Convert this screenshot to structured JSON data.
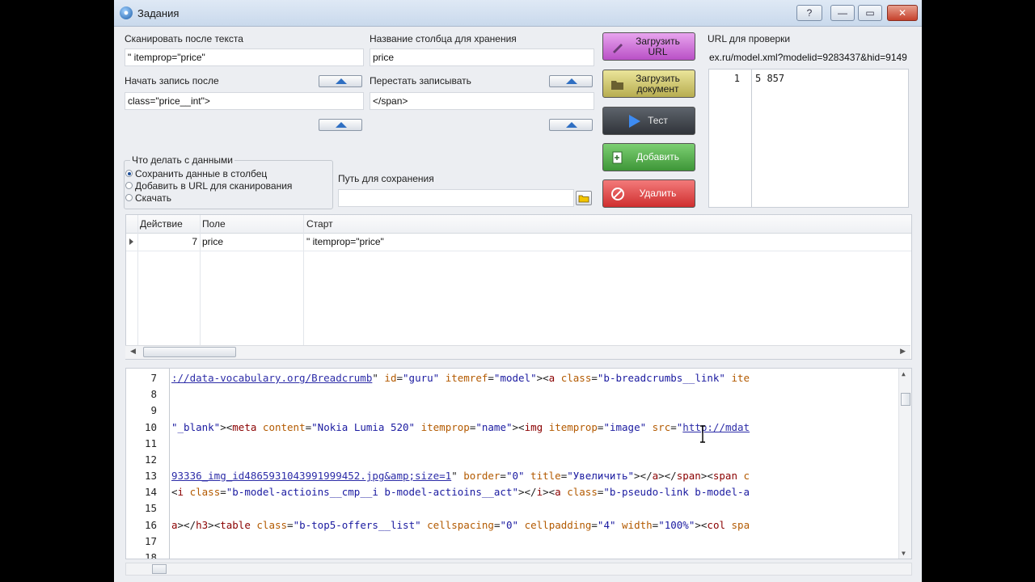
{
  "window": {
    "title": "Задания",
    "help_btn": "?",
    "min_btn": "—",
    "max_btn": "▭",
    "close_btn": "✕"
  },
  "form": {
    "scan_after_label": "Сканировать после текста",
    "scan_after_value": "\" itemprop=\"price\"",
    "column_label": "Название столбца для хранения",
    "column_value": "price",
    "start_after_label": "Начать запись после",
    "start_after_value": "class=\"price__int\">",
    "stop_label": "Перестать записывать",
    "stop_value": "</span>",
    "what_to_do_label": "Что делать с данными",
    "radio_options": [
      "Сохранить данные в столбец",
      "Добавить в URL для сканирования",
      "Скачать"
    ],
    "selected_option": "Сохранить данные в столбец",
    "save_path_label": "Путь для сохранения",
    "save_path_value": ""
  },
  "buttons": {
    "load_url": "Загрузить URL",
    "load_doc": "Загрузить документ",
    "test": "Тест",
    "add": "Добавить",
    "delete": "Удалить"
  },
  "colors": {
    "load_url": "#c56fd3",
    "load_doc": "#c9c06a",
    "test": "#3a3f46",
    "add": "#4faa4a",
    "delete": "#e04545"
  },
  "url_check": {
    "label": "URL для проверки",
    "value": "ex.ru/model.xml?modelid=9283437&hid=9149",
    "result_line_no": "1",
    "result_value": "5 857"
  },
  "grid": {
    "columns": [
      "Действие",
      "Поле",
      "Старт"
    ],
    "rows": [
      {
        "action": "7",
        "field": "price",
        "start": "\" itemprop=\"price\""
      }
    ]
  },
  "editor": {
    "line_numbers": [
      "7",
      "8",
      "9",
      "10",
      "11",
      "12",
      "13",
      "14",
      "15",
      "16",
      "17",
      "18"
    ]
  }
}
